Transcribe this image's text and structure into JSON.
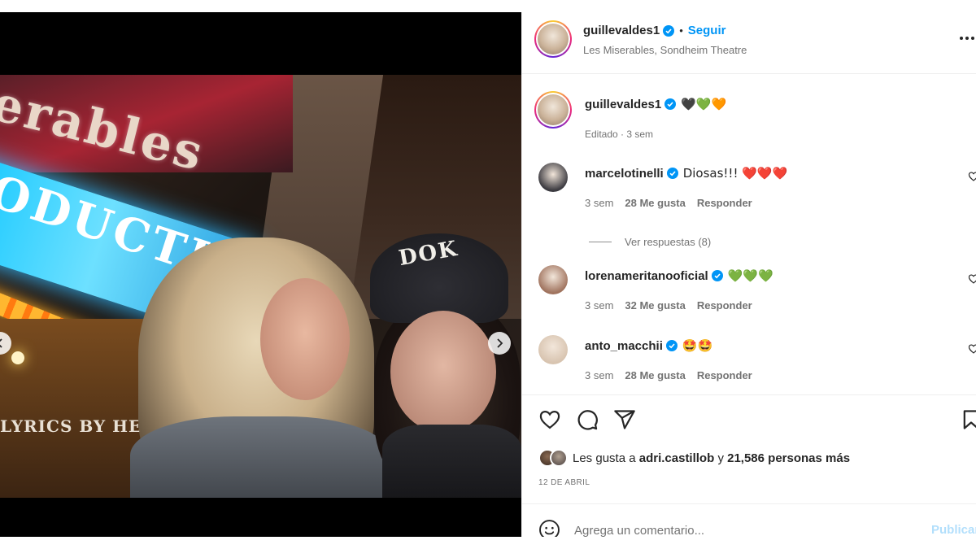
{
  "post": {
    "photo": {
      "marquee_text": "erables",
      "sign_text": "ODUCTIO",
      "lyrics_text": "LYRICS BY HERB",
      "cap_logo": "DOK",
      "carousel": {
        "total": 8,
        "active_index": 6
      }
    }
  },
  "header": {
    "username": "guillevaldes1",
    "separator": "•",
    "follow_label": "Seguir",
    "location": "Les Miserables, Sondheim Theatre"
  },
  "caption": {
    "username": "guillevaldes1",
    "text": "🖤💚🧡",
    "meta": "Editado · 3 sem"
  },
  "comments": [
    {
      "username": "marcelotinelli",
      "text": "Diosas!!! ❤️❤️❤️",
      "time": "3 sem",
      "likes": "28 Me gusta",
      "reply": "Responder",
      "avatar_color": "#3b3a40"
    },
    {
      "username": "lorenameritanooficial",
      "text": "💚💚💚",
      "time": "3 sem",
      "likes": "32 Me gusta",
      "reply": "Responder",
      "avatar_color": "#a0735e"
    },
    {
      "username": "anto_macchii",
      "text": "🤩🤩",
      "time": "3 sem",
      "likes": "28 Me gusta",
      "reply": "Responder",
      "avatar_color": "#d8c4b0"
    }
  ],
  "view_replies": "Ver respuestas (8)",
  "actions": {
    "like_icon": "heart-icon",
    "comment_icon": "comment-icon",
    "share_icon": "send-icon",
    "save_icon": "bookmark-icon"
  },
  "likes": {
    "prefix": "Les gusta a",
    "user": "adri.castillob",
    "conj": "y",
    "others": "21,586 personas más"
  },
  "date": "12 DE ABRIL",
  "comment_box": {
    "placeholder": "Agrega un comentario...",
    "publish_label": "Publicar"
  },
  "colors": {
    "accent": "#0095f6",
    "verified": "#0095f6",
    "muted": "#737373",
    "publish_disabled": "#b2dffc"
  }
}
